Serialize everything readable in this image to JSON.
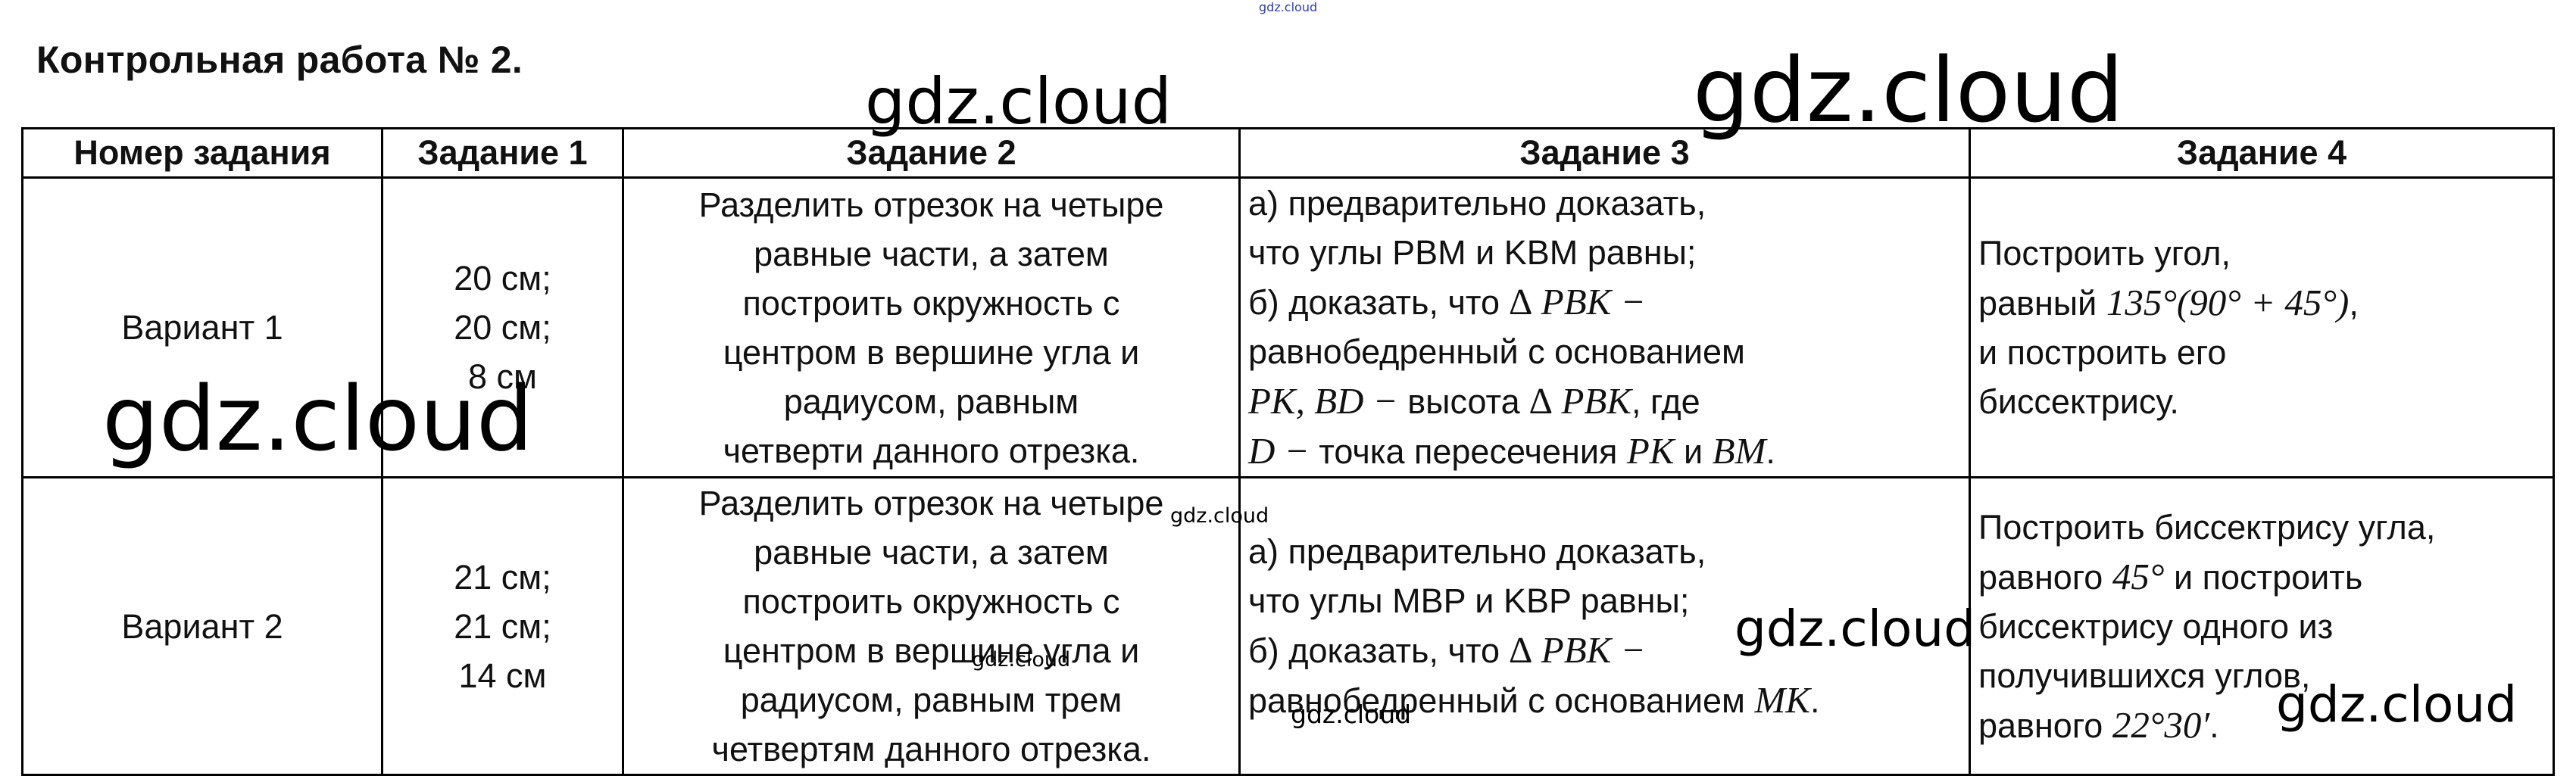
{
  "title": "Контрольная работа № 2.",
  "table": {
    "headers": [
      "Номер задания",
      "Задание 1",
      "Задание 2",
      "Задание 3",
      "Задание 4"
    ],
    "rows": [
      {
        "variant": "Вариант 1",
        "task1": [
          "20 см;",
          "20 см;",
          "8 см"
        ],
        "task2": [
          "Разделить отрезок на четыре",
          "равные части, а затем",
          "построить окружность с",
          "центром в вершине угла и",
          "радиусом, равным",
          "четверти данного отрезка."
        ],
        "task3": {
          "l1": "а) предварительно доказать,",
          "l2": "что углы PBM и KBM равны;",
          "l3_text": "б) доказать, что",
          "l3_math": "∆ PBK −",
          "l4": "равнобедренный с основанием",
          "l5_math1": "PK, BD −",
          "l5_text": "высота",
          "l5_math2": "∆ PBK",
          "l5_end": ", где",
          "l6_math1": "D −",
          "l6_text": "точка пересечения",
          "l6_math2": "PK",
          "l6_and": "и",
          "l6_math3": "BM",
          "l6_end": "."
        },
        "task4": {
          "l1": "Построить угол,",
          "l2_text": "равный",
          "l2_math": "135°(90° + 45°)",
          "l2_end": ",",
          "l3": "и построить его",
          "l4": "биссектрису."
        }
      },
      {
        "variant": "Вариант 2",
        "task1": [
          "21 см;",
          "21 см;",
          "14 см"
        ],
        "task2": [
          "Разделить отрезок на четыре",
          "равные части, а затем",
          "построить окружность с",
          "центром в вершине угла и",
          "радиусом, равным трем",
          "четвертям данного отрезка."
        ],
        "task3": {
          "l1": "а) предварительно доказать,",
          "l2": "что углы MBP и KBP равны;",
          "l3_text": "б) доказать, что",
          "l3_math": "∆ PBK −",
          "l4_text": "равнобедренный с основанием",
          "l4_math": "MK",
          "l4_end": "."
        },
        "task4": {
          "l1": "Построить биссектрису угла,",
          "l2_text": "равного",
          "l2_math": "45°",
          "l2_end": "и построить",
          "l3": "биссектрису одного из",
          "l4": "получившихся углов,",
          "l5_text": "равного",
          "l5_math": "22°30′",
          "l5_end": "."
        }
      }
    ]
  },
  "watermarks": {
    "big": "gdz.cloud",
    "medium": "gdz.cloud",
    "small": "gdz.cloud",
    "tiny": "gdz.cloud"
  }
}
